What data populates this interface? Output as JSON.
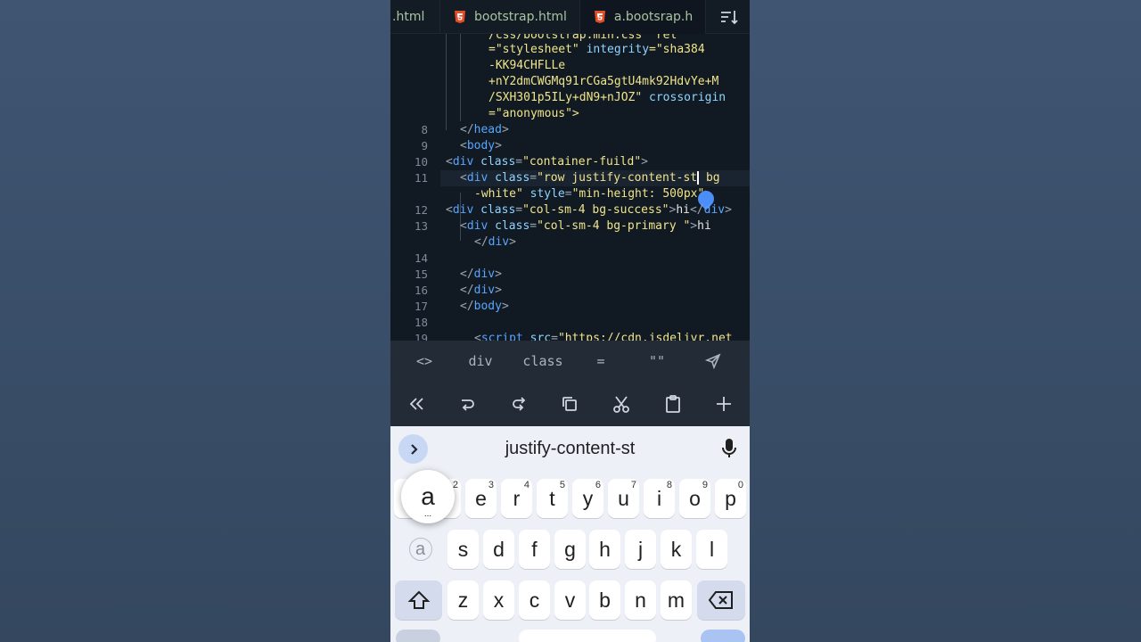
{
  "tabs": [
    {
      "label": ".html",
      "icon": "html5-icon"
    },
    {
      "label": "bootstrap.html",
      "icon": "html5-icon"
    },
    {
      "label": "a.bootsrap.h",
      "icon": "html5-icon"
    }
  ],
  "editor": {
    "wrapped_top": [
      "/css/bootstrap.min.css\" rel",
      "=\"stylesheet\"",
      "integrity",
      "=\"sha384",
      "-KK94CHFLLe",
      "+nY2dmCWGMq91rCGa5gtU4mk92HdvYe+M",
      "/SXH301p5ILy+dN9+nJOZ\"",
      "crossorigin",
      "=\"anonymous\">"
    ],
    "lines": {
      "n8": "8",
      "n9": "9",
      "n10": "10",
      "n11": "11",
      "n12": "12",
      "n13": "13",
      "n14": "14",
      "n15": "15",
      "n16": "16",
      "n17": "17",
      "n18": "18",
      "n19": "19"
    },
    "tokens": {
      "head": "head",
      "body": "body",
      "div": "div",
      "class": "class",
      "container": "\"container-fuild\"",
      "row_open": "\"row justify-content-st",
      "bg": "bg",
      "white": "-white\"",
      "style": "style",
      "style_val": "\"min-height: 500px\"",
      "col_success": "\"col-sm-4 bg-success\"",
      "col_primary": "\"col-sm-4 bg-primary \"",
      "hi": "hi",
      "script": "script",
      "src": "src",
      "src_val": "\"https://cdn.jsdelivr.net"
    }
  },
  "symbols": [
    "<>",
    "div",
    "class",
    "=",
    "\"\""
  ],
  "keyboard": {
    "suggestion": "justify-content-st",
    "row1": [
      {
        "k": "q",
        "n": "1"
      },
      {
        "k": "w",
        "n": "2"
      },
      {
        "k": "e",
        "n": "3"
      },
      {
        "k": "r",
        "n": "4"
      },
      {
        "k": "t",
        "n": "5"
      },
      {
        "k": "y",
        "n": "6"
      },
      {
        "k": "u",
        "n": "7"
      },
      {
        "k": "i",
        "n": "8"
      },
      {
        "k": "o",
        "n": "9"
      },
      {
        "k": "p",
        "n": "0"
      }
    ],
    "row2": [
      "a",
      "s",
      "d",
      "f",
      "g",
      "h",
      "j",
      "k",
      "l"
    ],
    "row3": [
      "z",
      "x",
      "c",
      "v",
      "b",
      "n",
      "m"
    ],
    "popup_key": "a",
    "popup_dots": "..."
  },
  "colors": {
    "tag": "#58a6ff",
    "attr": "#8fd5ff",
    "string": "#f0e58a",
    "background": "#111923"
  }
}
